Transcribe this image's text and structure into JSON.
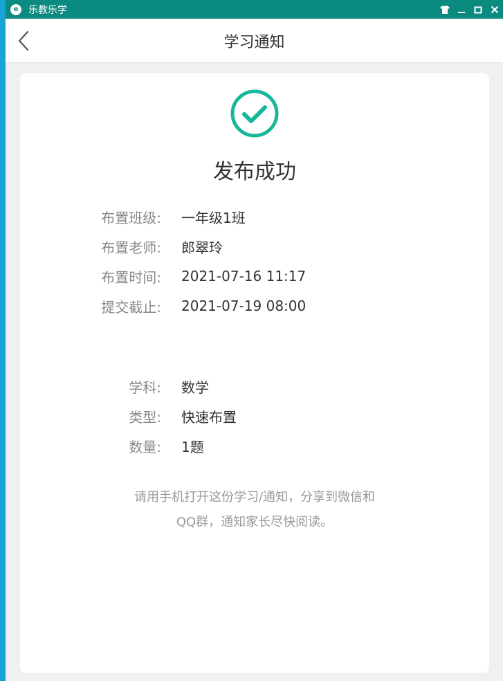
{
  "window": {
    "app_title": "乐教乐学"
  },
  "header": {
    "title": "学习通知"
  },
  "result": {
    "status_title": "发布成功"
  },
  "info": [
    {
      "label": "布置班级:",
      "value": "一年级1班"
    },
    {
      "label": "布置老师:",
      "value": "郎翠玲"
    },
    {
      "label": "布置时间:",
      "value": "2021-07-16 11:17"
    },
    {
      "label": "提交截止:",
      "value": "2021-07-19 08:00"
    }
  ],
  "detail": [
    {
      "label": "学科:",
      "value": "数学"
    },
    {
      "label": "类型:",
      "value": "快速布置"
    },
    {
      "label": "数量:",
      "value": "1题"
    }
  ],
  "hint": {
    "line1": "请用手机打开这份学习/通知，分享到微信和",
    "line2": "QQ群，通知家长尽快阅读。"
  },
  "colors": {
    "titlebar": "#0b8a80",
    "accent": "#17b79c",
    "label": "#888888",
    "value": "#333333"
  },
  "icons": [
    "back-arrow-icon",
    "check-circle-icon",
    "skin-icon",
    "minimize-icon",
    "maximize-icon",
    "close-icon",
    "app-logo-icon"
  ]
}
